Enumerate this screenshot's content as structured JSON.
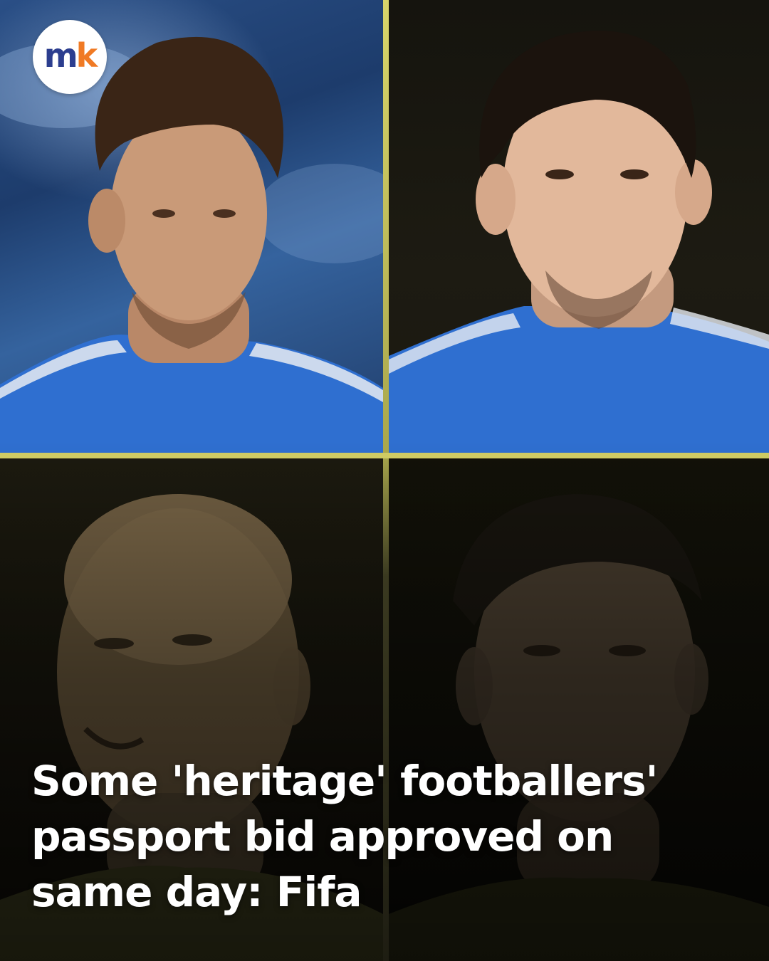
{
  "logo": {
    "letter_m": "m",
    "letter_k": "k",
    "colors": {
      "m": "#2c3e8f",
      "k": "#f07a24",
      "background": "#ffffff"
    }
  },
  "headline": {
    "text": "Some 'heritage' footballers' passport bid approved on same day: Fifa",
    "color": "#ffffff"
  },
  "photos": [
    {
      "description_icon": "player-portrait-icon",
      "jersey_color": "#2f6fd0"
    },
    {
      "description_icon": "player-portrait-icon",
      "jersey_color": "#2f6fd0"
    },
    {
      "description_icon": "player-portrait-icon",
      "jersey_color": "#3a3a1e"
    },
    {
      "description_icon": "player-portrait-icon",
      "jersey_color": "#262612"
    }
  ],
  "divider_color": "#cfcb63"
}
